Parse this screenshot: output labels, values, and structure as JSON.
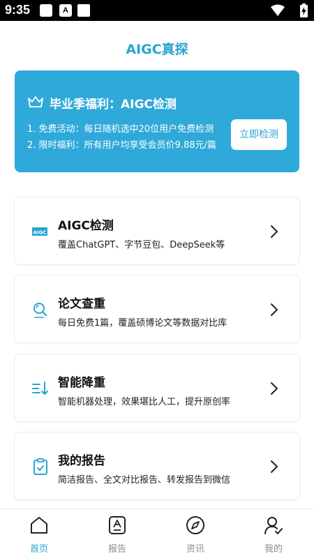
{
  "status_bar": {
    "time": "9:35",
    "notif_icon_label": "A"
  },
  "app": {
    "title": "AIGC真探"
  },
  "banner": {
    "title": "毕业季福利：AIGC检测",
    "line1": "1. 免费活动：每日随机选中20位用户免费检测",
    "line2": "2. 限时福利：所有用户均享受会员价9.88元/篇",
    "button": "立即检测"
  },
  "services": [
    {
      "title": "AIGC检测",
      "subtitle": "覆盖ChatGPT、字节豆包、DeepSeek等",
      "icon": "aigc-badge-icon",
      "badge": "AIGC"
    },
    {
      "title": "论文查重",
      "subtitle": "每日免费1篇，覆盖硕博论文等数据对比库",
      "icon": "search-icon"
    },
    {
      "title": "智能降重",
      "subtitle": "智能机器处理，效果堪比人工，提升原创率",
      "icon": "sort-down-icon"
    },
    {
      "title": "我的报告",
      "subtitle": "简洁报告、全文对比报告、转发报告到微信",
      "icon": "clipboard-check-icon"
    }
  ],
  "tabs": [
    {
      "label": "首页",
      "icon": "home-icon",
      "active": true
    },
    {
      "label": "报告",
      "icon": "report-icon",
      "active": false
    },
    {
      "label": "资讯",
      "icon": "compass-icon",
      "active": false
    },
    {
      "label": "我的",
      "icon": "user-icon",
      "active": false
    }
  ],
  "colors": {
    "accent": "#2aa3d1",
    "banner_bg": "#2fa9d9",
    "tab_inactive": "#8a8a8a"
  }
}
